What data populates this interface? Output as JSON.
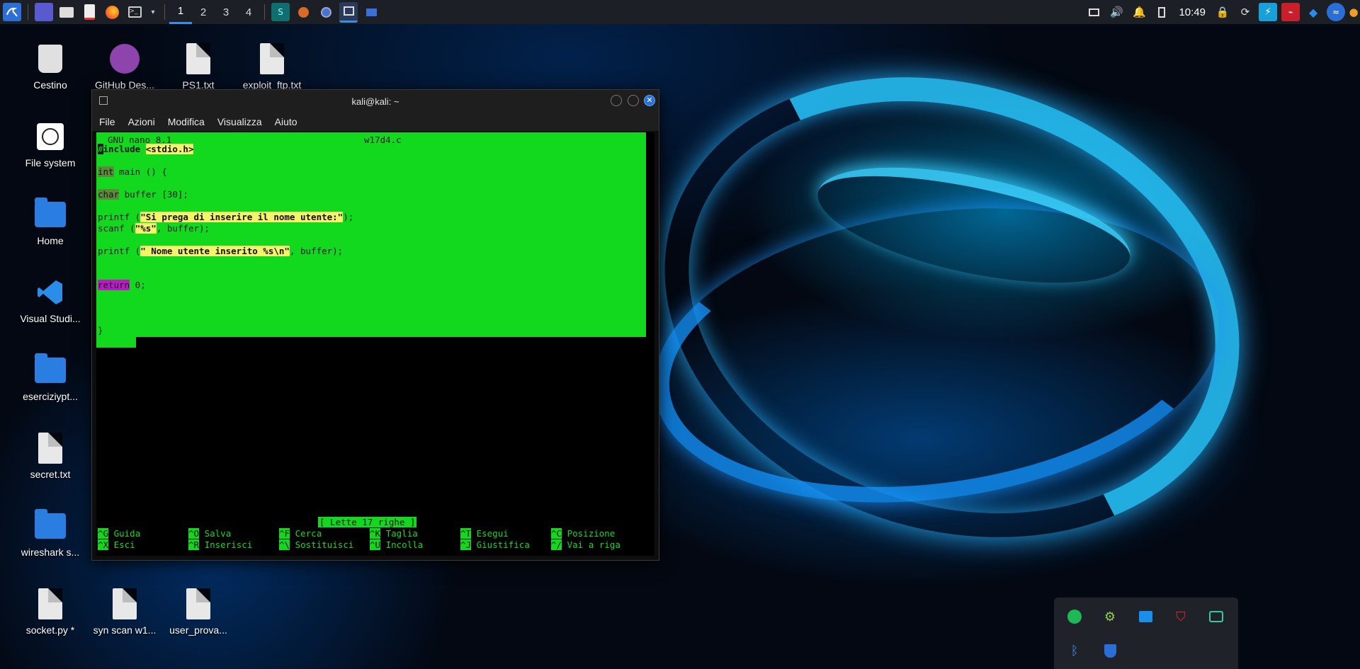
{
  "panel": {
    "workspaces": [
      "1",
      "2",
      "3",
      "4"
    ],
    "clock": "10:49"
  },
  "desktop": {
    "icons": [
      {
        "label": "Cestino",
        "icon": "trash-icon"
      },
      {
        "label": "GitHub Des...",
        "icon": "github-icon"
      },
      {
        "label": "PS1.txt",
        "icon": "text-file-icon"
      },
      {
        "label": "exploit_ftp.txt",
        "icon": "text-file-icon"
      },
      {
        "label": "File system",
        "icon": "drive-icon"
      },
      {
        "label": "Home",
        "icon": "home-folder-icon"
      },
      {
        "label": "Visual Studi...",
        "icon": "vscode-icon"
      },
      {
        "label": "eserciziypt...",
        "icon": "folder-link-icon"
      },
      {
        "label": "secret.txt",
        "icon": "text-file-icon"
      },
      {
        "label": "wireshark s...",
        "icon": "folder-icon"
      },
      {
        "label": "socket.py *",
        "icon": "locked-file-icon"
      },
      {
        "label": "syn scan w1...",
        "icon": "binary-file-icon"
      },
      {
        "label": "user_prova...",
        "icon": "text-file-icon"
      }
    ]
  },
  "terminal": {
    "title": "kali@kali: ~",
    "menu": [
      "File",
      "Azioni",
      "Modifica",
      "Visualizza",
      "Aiuto"
    ],
    "nano_version": "GNU nano 8.1",
    "filename": "w17d4.c",
    "code": {
      "include_hash": "#",
      "include_kw": "include",
      "include_hdr": "<stdio.h>",
      "int_kw": "int",
      "main_rest": " main () {",
      "char_kw": "char",
      "buffer_rest": " buffer [30];",
      "printf1_pre": "printf (",
      "printf1_str": "\"Si prega di inserire il nome utente:\"",
      "printf1_post": ");",
      "scanf_pre": "scanf (",
      "scanf_str": "\"%s\"",
      "scanf_post": ", buffer);",
      "printf2_pre": "printf (",
      "printf2_str": "\" Nome utente inserito %s\\n\"",
      "printf2_post": ", buffer);",
      "return_kw": "return",
      "return_rest": " 0;",
      "close_brace": "}"
    },
    "status": "[ Lette 17 righe ]",
    "shortcuts": [
      {
        "key": "^G",
        "label": "Guida"
      },
      {
        "key": "^O",
        "label": "Salva"
      },
      {
        "key": "^F",
        "label": "Cerca"
      },
      {
        "key": "^K",
        "label": "Taglia"
      },
      {
        "key": "^T",
        "label": "Esegui"
      },
      {
        "key": "^C",
        "label": "Posizione"
      },
      {
        "key": "^X",
        "label": "Esci"
      },
      {
        "key": "^R",
        "label": "Inserisci"
      },
      {
        "key": "^\\",
        "label": "Sostituisci"
      },
      {
        "key": "^U",
        "label": "Incolla"
      },
      {
        "key": "^J",
        "label": "Giustifica"
      },
      {
        "key": "^/",
        "label": "Vai a riga"
      }
    ]
  },
  "colors": {
    "nano_bg": "#12d81e",
    "highlight": "#f4f46a",
    "return_kw": "#c018c8",
    "accent": "#3a8ee6"
  }
}
